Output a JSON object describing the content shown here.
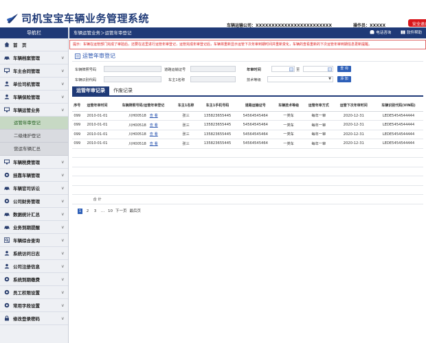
{
  "app": {
    "title": "司机宝宝车辆业务管理系统",
    "company": "车辆运输公司：XXXXXXXXXXXXXXXXXXXXXXXX",
    "operator": "操作员：XXXXX",
    "logout": "安全退出"
  },
  "sidebar": {
    "title": "导航栏",
    "items": [
      {
        "label": "首　页",
        "icon": "home-icon",
        "chev": ""
      },
      {
        "label": "车辆档案管理",
        "icon": "car-icon",
        "chev": "v"
      },
      {
        "label": "车主合同管理",
        "icon": "monitor-icon",
        "chev": "v"
      },
      {
        "label": "单位司机管理",
        "icon": "user-icon",
        "chev": "v"
      },
      {
        "label": "车辆保险管理",
        "icon": "user-icon",
        "chev": "v"
      },
      {
        "label": "车辆运管业务",
        "icon": "monitor-icon",
        "chev": "v"
      }
    ],
    "subitems": [
      "运管年审登记",
      "二级维护登记",
      "营运车辆汇总"
    ],
    "items2": [
      {
        "label": "车辆税费管理",
        "icon": "monitor-icon",
        "chev": "v"
      },
      {
        "label": "挂靠车辆管理",
        "icon": "gear-icon",
        "chev": "v"
      },
      {
        "label": "车辆官司诉讼",
        "icon": "car-icon",
        "chev": "v"
      },
      {
        "label": "公司财务管理",
        "icon": "gear-icon",
        "chev": "v"
      },
      {
        "label": "数据统计汇总",
        "icon": "car-icon",
        "chev": "v"
      },
      {
        "label": "业务到期提醒",
        "icon": "car-icon",
        "chev": "v"
      },
      {
        "label": "车辆综合查询",
        "icon": "search-icon",
        "chev": "v"
      },
      {
        "label": "系统访问日志",
        "icon": "user-icon",
        "chev": "v"
      },
      {
        "label": "公司注册信息",
        "icon": "user-icon",
        "chev": "v"
      },
      {
        "label": "系统到期缴费",
        "icon": "gear-icon",
        "chev": "v"
      },
      {
        "label": "员工权限设置",
        "icon": "gear-icon",
        "chev": "v"
      },
      {
        "label": "常用字段设置",
        "icon": "gear-icon",
        "chev": "v"
      },
      {
        "label": "修改登录密码",
        "icon": "lock-icon",
        "chev": "v"
      }
    ]
  },
  "crumb": {
    "path": "车辆运管业务＞运管年审登记",
    "phone": "电话咨询",
    "help": "软件帮助"
  },
  "notice": "提示：车辆在运管部门完成了审验后，还要在这里进行运管年审登记，运管完成年审登记后，车辆将重新显示运管下次年审到期时间并重新变化，车辆的查看重新的下次运管年审到期信息更新提醒。",
  "section": {
    "title": "运管年审登记"
  },
  "form": {
    "plate_label": "车辆牌照号码",
    "permit_label": "道路运输证号",
    "date_label": "年审时间",
    "date_sep": "至",
    "query_btn": "查 询",
    "vin_label": "车辆识别代码",
    "owner_label": "车主1名称",
    "grade_label": "技术等级",
    "add_btn": "添 加"
  },
  "tabs": [
    "运管年审记录",
    "作废记录"
  ],
  "table": {
    "headers": [
      "序号",
      "运管年审时间",
      "车辆牌照号码/运管年审登记",
      "车主1名称",
      "车主1手机号码",
      "道路运输证号",
      "车辆技术等级",
      "运管年审方式",
      "运管下次年审时间",
      "车辆识别代码(VIN码)"
    ],
    "rows": [
      {
        "no": "099",
        "date": "2010-01-01",
        "plate": "川H00518",
        "link": "查 看",
        "owner": "张三",
        "phone": "135823655445",
        "permit": "54564545464",
        "grade": "一类车",
        "mode": "每年一审",
        "next": "2020-12-31",
        "vin": "LEDE5454544444"
      },
      {
        "no": "099",
        "date": "2010-01-01",
        "plate": "川H00518",
        "link": "查 看",
        "owner": "张三",
        "phone": "135823655445",
        "permit": "54564545464",
        "grade": "一类车",
        "mode": "每年一审",
        "next": "2020-12-31",
        "vin": "LEDE5454544444"
      },
      {
        "no": "099",
        "date": "2010-01-01",
        "plate": "川H00518",
        "link": "查 看",
        "owner": "张三",
        "phone": "135823655445",
        "permit": "54564545464",
        "grade": "一类车",
        "mode": "每年一审",
        "next": "2020-12-31",
        "vin": "LEDE5454544444"
      },
      {
        "no": "099",
        "date": "2010-01-01",
        "plate": "川H00518",
        "link": "查 看",
        "owner": "张三",
        "phone": "135823655445",
        "permit": "54564545464",
        "grade": "一类车",
        "mode": "每年一审",
        "next": "2020-12-31",
        "vin": "LEDE5454544444"
      }
    ],
    "total_label": "合 计"
  },
  "pager": {
    "pages": [
      "1",
      "2",
      "3",
      "…",
      "10"
    ],
    "next": "下一页",
    "last": "最后页"
  },
  "colors": {
    "primary": "#1f3a77",
    "accent": "#2d5fb8",
    "danger": "#d8161b",
    "active_bg": "#c7d9c4"
  }
}
